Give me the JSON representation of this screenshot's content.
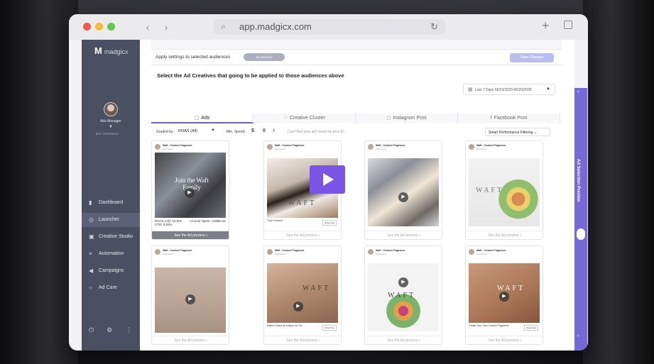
{
  "browser": {
    "url": "app.madgicx.com"
  },
  "sidebar": {
    "logo": "madgicx",
    "account_label": "Ads Manager",
    "account_sub": "E-commerce",
    "items": [
      {
        "label": "Dashboard",
        "icon": "bar-chart-icon"
      },
      {
        "label": "Launcher",
        "icon": "globe-icon"
      },
      {
        "label": "Creative Studio",
        "icon": "image-icon"
      },
      {
        "label": "Automation",
        "icon": "sliders-icon"
      },
      {
        "label": "Campaigns",
        "icon": "megaphone-icon"
      },
      {
        "label": "Ad Care",
        "icon": "circle-icon"
      }
    ]
  },
  "apply_bar": {
    "label": "Apply settings to selected audiences",
    "selected": "16 selected",
    "save": "Save Changes"
  },
  "section_title": "Select the Ad Creatives that going to be applied to those audiences above",
  "date_filter": "Last 7 Days   06/23/2020-06/29/2020",
  "tabs": [
    {
      "label": "Ads"
    },
    {
      "label": "Creative Cluster"
    },
    {
      "label": "Instagram Post"
    },
    {
      "label": "Facebook Post"
    }
  ],
  "filters": {
    "graded_by": "Graded by:",
    "graded_value": "ROAS (All)",
    "min_spend": "Min. Spend:",
    "currency": "$",
    "spend_value": "0",
    "cant_find": "Can't find your ad? Insert by post ID",
    "smart": "Smart Performance Filtering"
  },
  "cards": [
    {
      "name": "Waft - Custom Fragrance",
      "sponsored": "Sponsored",
      "overlay": "Join the Waft Family",
      "roas": "ROAS (All): 12.83x",
      "spent": "Amount Spent: US$53.61",
      "ctr": "CTR: 0.83%",
      "preview": "See the Ad preview"
    },
    {
      "name": "Waft - Custom Fragrance",
      "sponsored": "Sponsored",
      "foot": "Treat Yourself",
      "shop": "Shop Now",
      "preview": "See the Ad preview"
    },
    {
      "name": "Waft - Custom Fragrance",
      "sponsored": "Sponsored",
      "preview": "See the Ad preview"
    },
    {
      "name": "Waft - Custom Fragrance",
      "sponsored": "Sponsored",
      "preview": "See the Ad preview"
    },
    {
      "name": "Waft - Custom Fragrance",
      "sponsored": "Sponsored",
      "preview": "See the Ad preview"
    },
    {
      "name": "Waft - Custom Fragrance",
      "sponsored": "Sponsored",
      "foot": "Make a Scent as Unique as You",
      "shop": "Shop Now",
      "preview": "See the Ad preview"
    },
    {
      "name": "Waft - Custom Fragrance",
      "sponsored": "Sponsored",
      "preview": "See the Ad preview"
    },
    {
      "name": "Waft - Custom Fragrance",
      "sponsored": "Sponsored",
      "foot": "Create Your Own Custom Fragrance",
      "shop": "Shop Now",
      "preview": "See the Ad preview"
    }
  ],
  "brand_word": "WAFT",
  "right_panel": {
    "label": "Ad Selection Preview"
  },
  "colors": {
    "sidebar": "#4a4f61",
    "accent": "#7668d8",
    "play": "#7a55e6"
  }
}
